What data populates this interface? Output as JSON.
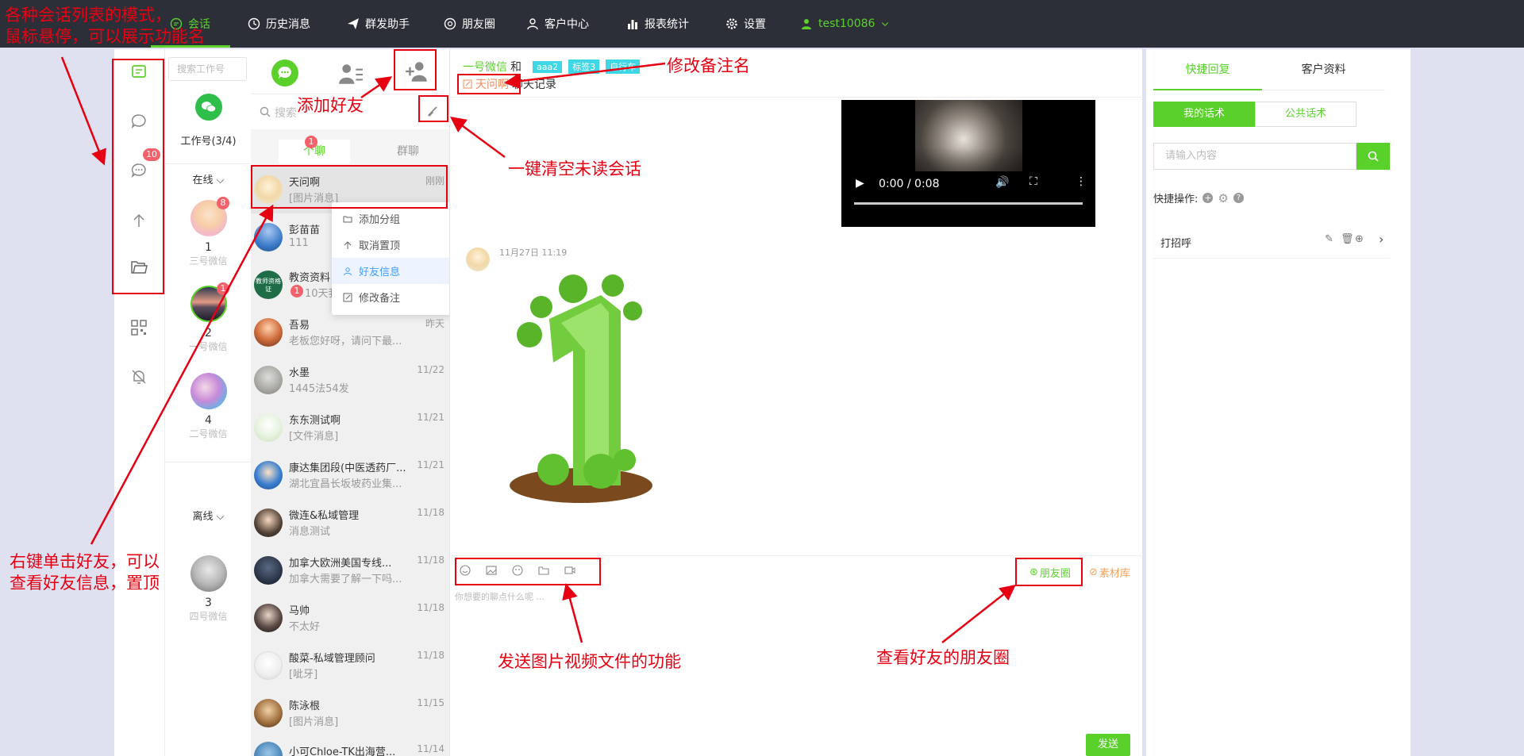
{
  "nav": {
    "items": [
      {
        "label": "会话",
        "icon": "chat-bubble-icon"
      },
      {
        "label": "历史消息",
        "icon": "clock-icon"
      },
      {
        "label": "群发助手",
        "icon": "send-icon"
      },
      {
        "label": "朋友圈",
        "icon": "aperture-icon"
      },
      {
        "label": "客户中心",
        "icon": "user-icon"
      },
      {
        "label": "报表统计",
        "icon": "bar-chart-icon"
      },
      {
        "label": "设置",
        "icon": "gear-icon"
      }
    ],
    "user": "test10086",
    "colors": {
      "bar": "#2d2f38",
      "accent": "#5ad12b"
    }
  },
  "rail": {
    "unread_badge": "10"
  },
  "accounts": {
    "search_placeholder": "搜索工作号",
    "count_label": "工作号(3/4)",
    "online_label": "在线",
    "offline_label": "离线",
    "items": [
      {
        "num": "1",
        "label": "三号微信",
        "badge": "8"
      },
      {
        "num": "2",
        "label": "一号微信",
        "badge": "1"
      },
      {
        "num": "4",
        "label": "二号微信",
        "badge": ""
      },
      {
        "num": "3",
        "label": "四号微信",
        "badge": ""
      }
    ]
  },
  "contacts": {
    "search_placeholder": "搜索",
    "tabs": [
      {
        "label": "个聊",
        "badge": "1"
      },
      {
        "label": "群聊",
        "badge": ""
      }
    ],
    "items": [
      {
        "name": "天问啊",
        "preview": "[图片消息]",
        "time": "刚刚"
      },
      {
        "name": "彭苗苗",
        "preview": "111",
        "time": ""
      },
      {
        "name": "教资资料",
        "preview": "10天我",
        "time": "",
        "avatar_text": "教师资格证",
        "badge": "1"
      },
      {
        "name": "吾易",
        "preview": "老板您好呀，请问下最...",
        "time": "昨天"
      },
      {
        "name": "水墨",
        "preview": "1445法54发",
        "time": "11/22"
      },
      {
        "name": "东东测试啊",
        "preview": "[文件消息]",
        "time": "11/21"
      },
      {
        "name": "康达集团段(中医透药厂...",
        "preview": "湖北宜昌长坂坡药业集...",
        "time": "11/21"
      },
      {
        "name": "微连&私域管理",
        "preview": "消息测试",
        "time": "11/18"
      },
      {
        "name": "加拿大欧洲美国专线...",
        "preview": "加拿大需要了解一下吗...",
        "time": "11/18"
      },
      {
        "name": "马帅",
        "preview": "不太好",
        "time": "11/18"
      },
      {
        "name": "酸菜-私域管理顾问",
        "preview": "[呲牙]",
        "time": "11/18"
      },
      {
        "name": "陈泳根",
        "preview": "[图片消息]",
        "time": "11/15"
      },
      {
        "name": "小可Chloe-TK出海营...",
        "preview": "",
        "time": "11/14"
      }
    ],
    "context_menu": [
      "添加分组",
      "取消置顶",
      "好友信息",
      "修改备注"
    ]
  },
  "chat": {
    "account_name": "一号微信",
    "and_text": "和",
    "tags": [
      "aaa2",
      "标签3",
      "自行车"
    ],
    "contact_name": "天问啊",
    "title_suffix": "聊天记录",
    "video_time": "0:00 / 0:08",
    "message_time": "11月27日 11:19",
    "input_placeholder": "你想要的聊点什么呢 ...",
    "moments_btn": "朋友圈",
    "material_btn": "素材库",
    "send_btn": "发送"
  },
  "right": {
    "tabs": [
      "快捷回复",
      "客户资料"
    ],
    "sub_tabs": [
      "我的话术",
      "公共话术"
    ],
    "search_placeholder": "请输入内容",
    "quick_ops_label": "快捷操作:",
    "group_item": "打招呼"
  },
  "annotations": {
    "top_left": "各种会话列表的模式，\n鼠标悬停，可以展示功能名",
    "add_friend": "添加好友",
    "edit_remark": "修改备注名",
    "clear_unread": "一键清空未读会话",
    "right_click": "右键单击好友，可以\n查看好友信息，置顶",
    "send_media": "发送图片视频文件的功能",
    "view_moments": "查看好友的朋友圈"
  }
}
